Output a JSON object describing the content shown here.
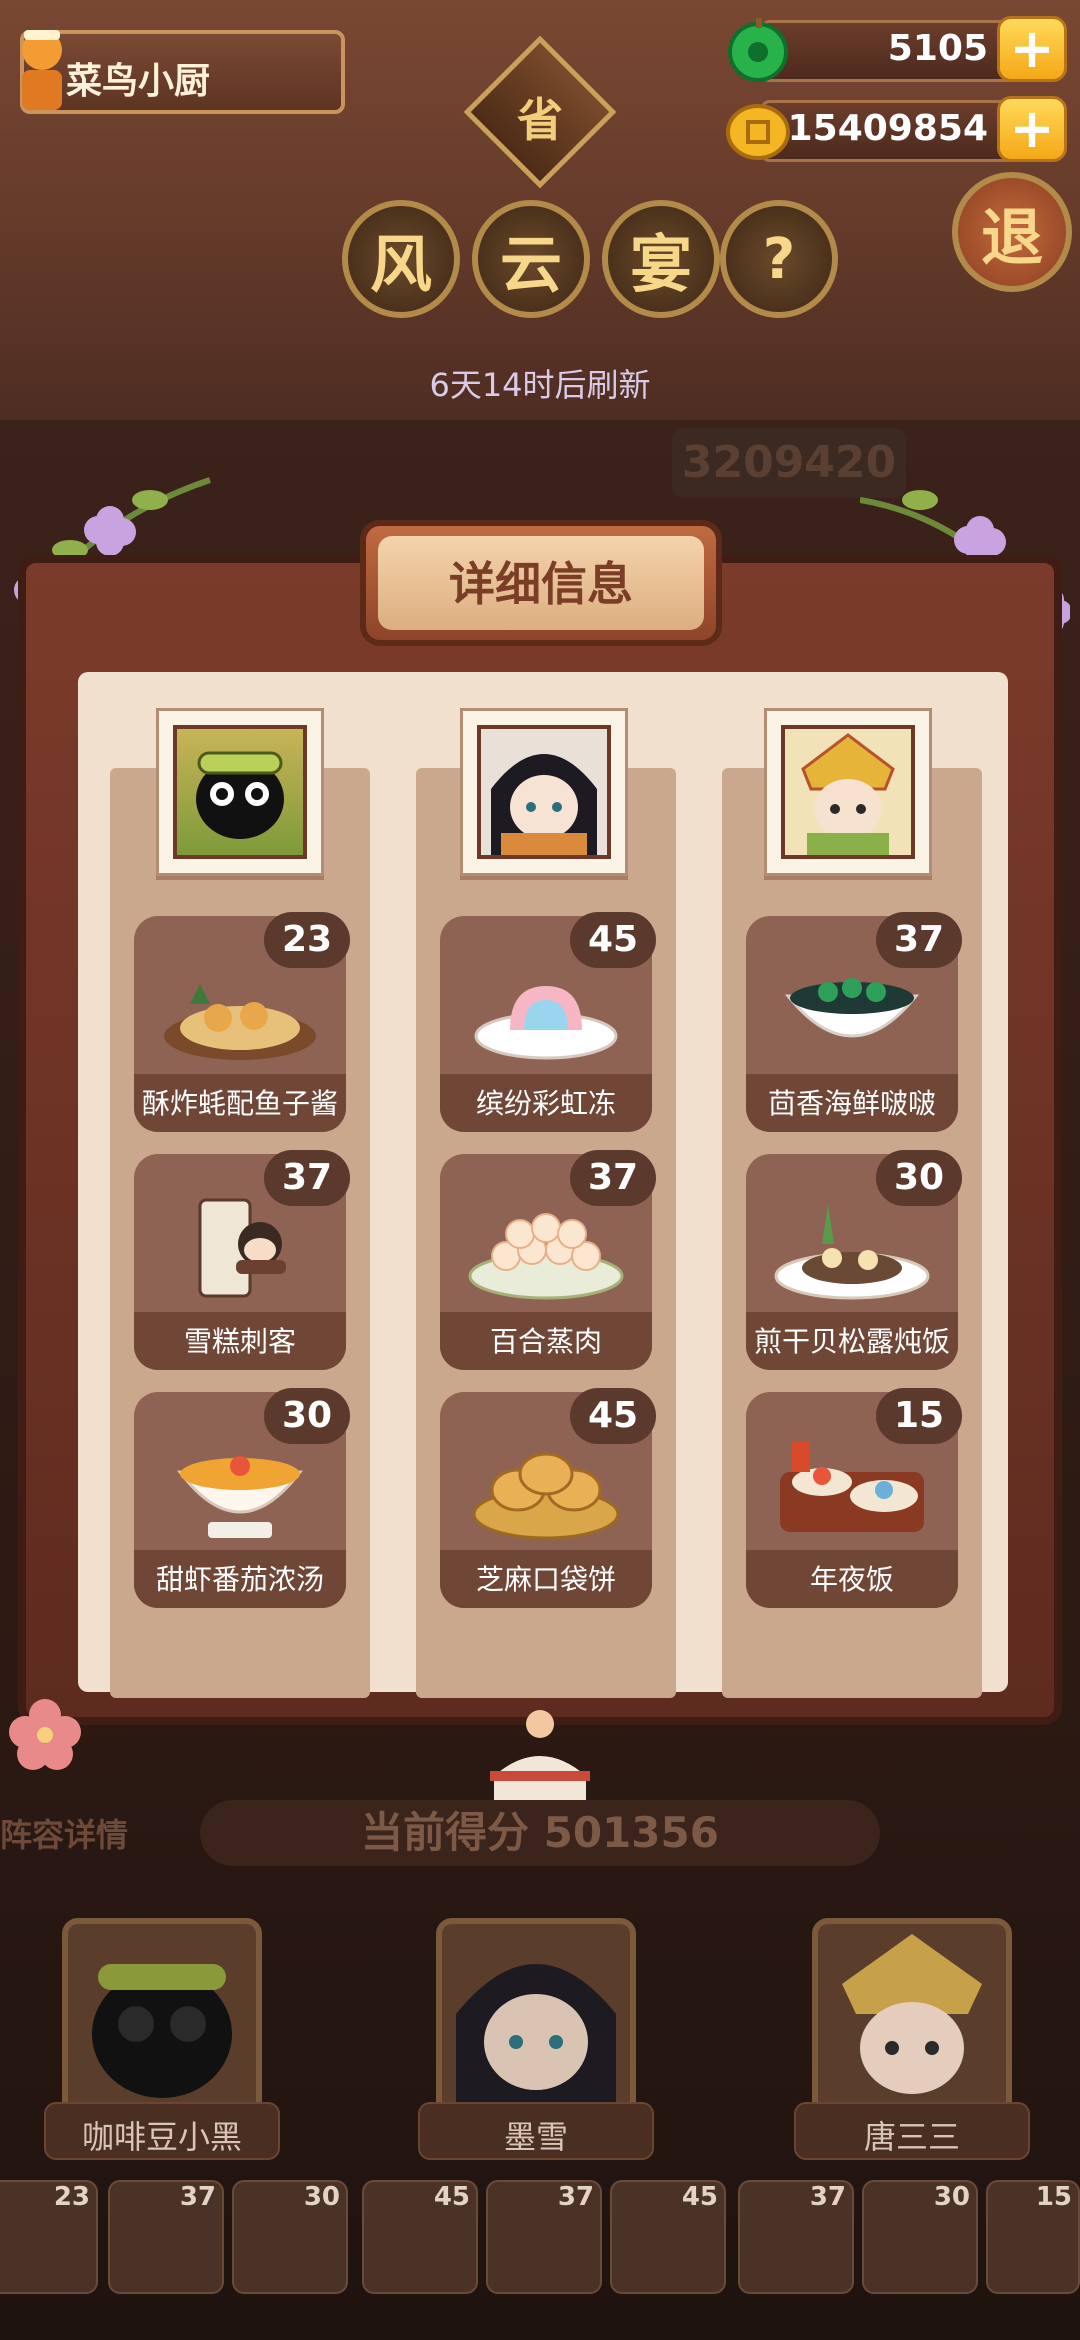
{
  "player": {
    "name": "菜鸟小厨"
  },
  "currency": {
    "jade": "5105",
    "coins": "15409854"
  },
  "header": {
    "badge_char": "省",
    "title_chars": [
      "风",
      "云",
      "宴"
    ],
    "help_char": "?",
    "exit_char": "退",
    "refresh_text": "6天14时后刷新",
    "score_top": "3209420"
  },
  "modal": {
    "title": "详细信息",
    "columns": [
      {
        "dishes": [
          {
            "name": "酥炸蚝配鱼子酱",
            "count": "23"
          },
          {
            "name": "雪糕刺客",
            "count": "37"
          },
          {
            "name": "甜虾番茄浓汤",
            "count": "30"
          }
        ]
      },
      {
        "dishes": [
          {
            "name": "缤纷彩虹冻",
            "count": "45"
          },
          {
            "name": "百合蒸肉",
            "count": "37"
          },
          {
            "name": "芝麻口袋饼",
            "count": "45"
          }
        ]
      },
      {
        "dishes": [
          {
            "name": "茴香海鲜啵啵",
            "count": "37"
          },
          {
            "name": "煎干贝松露炖饭",
            "count": "30"
          },
          {
            "name": "年夜饭",
            "count": "15"
          }
        ]
      }
    ]
  },
  "bottom": {
    "left_label": "阵容详情",
    "score_text": "当前得分 501356",
    "heroes": [
      "咖啡豆小黑",
      "墨雪",
      "唐三三"
    ],
    "strip_counts": [
      "23",
      "37",
      "30",
      "45",
      "37",
      "45",
      "37",
      "30",
      "15"
    ]
  },
  "colors": {
    "accent": "#f5a816",
    "panel": "#f0e0cd",
    "card": "#8f6353"
  }
}
